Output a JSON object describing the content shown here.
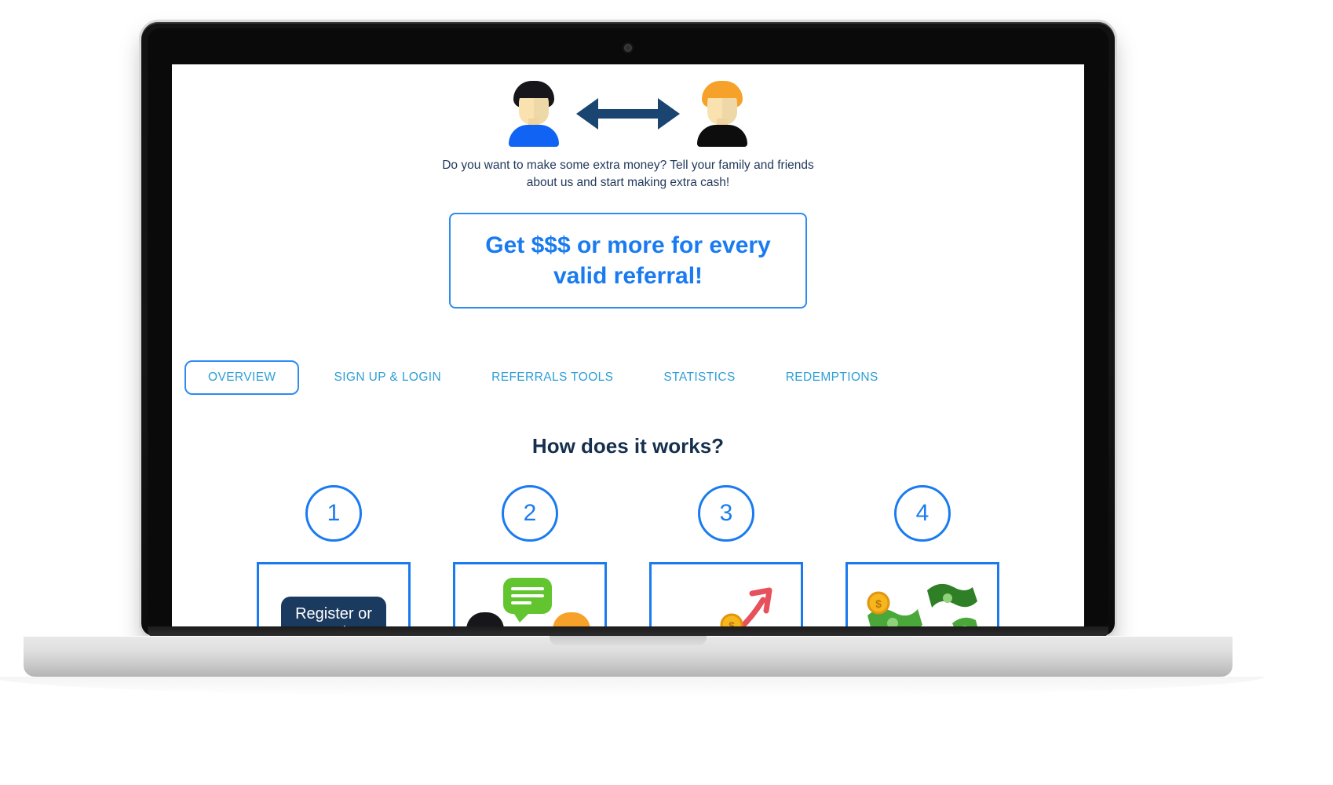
{
  "device": {
    "name": "laptop-mockup",
    "webcam": "webcam-dot"
  },
  "page": {
    "hero": {
      "left_avatar": "person-blue-shirt-icon",
      "right_avatar": "person-black-shirt-icon",
      "arrow": "double-arrow-icon",
      "subtitle_line1": "Do you want to make some extra money? Tell your family and friends",
      "subtitle_line2": "about us and start making extra cash!"
    },
    "cta": {
      "line1": "Get $$$ or more for every",
      "line2": "valid referral!"
    },
    "tabs": [
      {
        "label": "OVERVIEW",
        "active": true
      },
      {
        "label": "SIGN UP & LOGIN",
        "active": false
      },
      {
        "label": "REFERRALS TOOLS",
        "active": false
      },
      {
        "label": "STATISTICS",
        "active": false
      },
      {
        "label": "REDEMPTIONS",
        "active": false
      }
    ],
    "section_title": "How does it works?",
    "steps": [
      {
        "number": "1",
        "art": "register-button-card",
        "button_label": "Register or\nLog in"
      },
      {
        "number": "2",
        "art": "chat-avatars-card"
      },
      {
        "number": "3",
        "art": "growth-arrow-coin-card"
      },
      {
        "number": "4",
        "art": "money-bills-coins-card"
      }
    ]
  },
  "colors": {
    "accent_blue": "#1a7bf0",
    "tab_blue": "#2e9fd6",
    "dark_navy": "#1b3a5f",
    "text_navy": "#22395c",
    "heading_navy": "#15304d",
    "green_bubble": "#62c530",
    "coin_gold": "#f7b61d",
    "money_green": "#4aa83a",
    "arrow_red": "#e8505b",
    "hair_orange": "#f6a22a"
  }
}
